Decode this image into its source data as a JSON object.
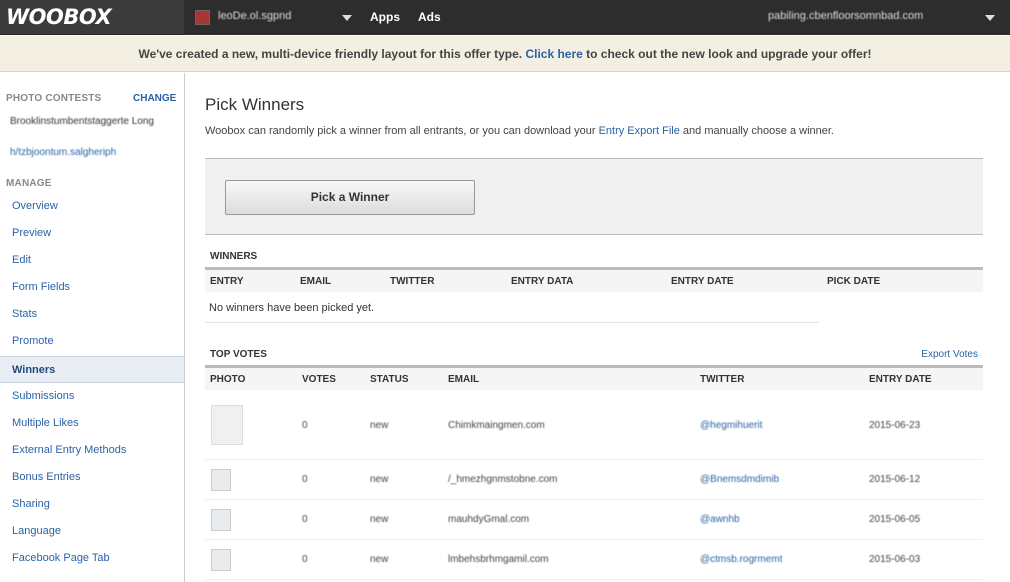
{
  "topbar": {
    "logo": "WOOBOX",
    "page_name": "leoDe.ol.sgpnd",
    "nav": [
      "Apps",
      "Ads"
    ],
    "account": "pabiling.cbenfloorsomnbad.com"
  },
  "notice": {
    "before": "We've created a new, multi-device friendly layout for this offer type. ",
    "link": "Click here",
    "after": " to check out the new look and upgrade your offer!"
  },
  "sidebar": {
    "contests_heading": "PHOTO CONTESTS",
    "change_label": "CHANGE",
    "contest_title": "Brooklinstumbentstaggerte Long",
    "contest_url": "h/tzbjoontum.salgheriph",
    "manage_heading": "MANAGE",
    "items": [
      "Overview",
      "Preview",
      "Edit",
      "Form Fields",
      "Stats",
      "Promote",
      "Winners",
      "Submissions",
      "Multiple Likes",
      "External Entry Methods",
      "Bonus Entries",
      "Sharing",
      "Language",
      "Facebook Page Tab"
    ],
    "active_index": 6
  },
  "main": {
    "title": "Pick Winners",
    "intro_before": "Woobox can randomly pick a winner from all entrants, or you can download your ",
    "intro_link": "Entry Export File",
    "intro_after": " and manually choose a winner.",
    "pick_button": "Pick a Winner",
    "winners": {
      "heading": "WINNERS",
      "columns": [
        "ENTRY",
        "EMAIL",
        "TWITTER",
        "ENTRY DATA",
        "ENTRY DATE",
        "PICK DATE"
      ],
      "empty_message": "No winners have been picked yet."
    },
    "top_votes": {
      "heading": "TOP VOTES",
      "export_label": "Export Votes",
      "columns": [
        "PHOTO",
        "VOTES",
        "STATUS",
        "EMAIL",
        "TWITTER",
        "ENTRY DATE"
      ],
      "rows": [
        {
          "votes": "0",
          "status": "new",
          "email": "Chimkmaingmen.com",
          "twitter": "@hegmihuerit",
          "date": "2015-06-23"
        },
        {
          "votes": "0",
          "status": "new",
          "email": "/_hmezhgnmstobne.com",
          "twitter": "@Bnemsdmdimib",
          "date": "2015-06-12"
        },
        {
          "votes": "0",
          "status": "new",
          "email": "mauhdyGmal.com",
          "twitter": "@awnhb",
          "date": "2015-06-05"
        },
        {
          "votes": "0",
          "status": "new",
          "email": "lmbehsbrhmgamil.com",
          "twitter": "@ctmsb.rogrmemt",
          "date": "2015-06-03"
        }
      ]
    }
  }
}
